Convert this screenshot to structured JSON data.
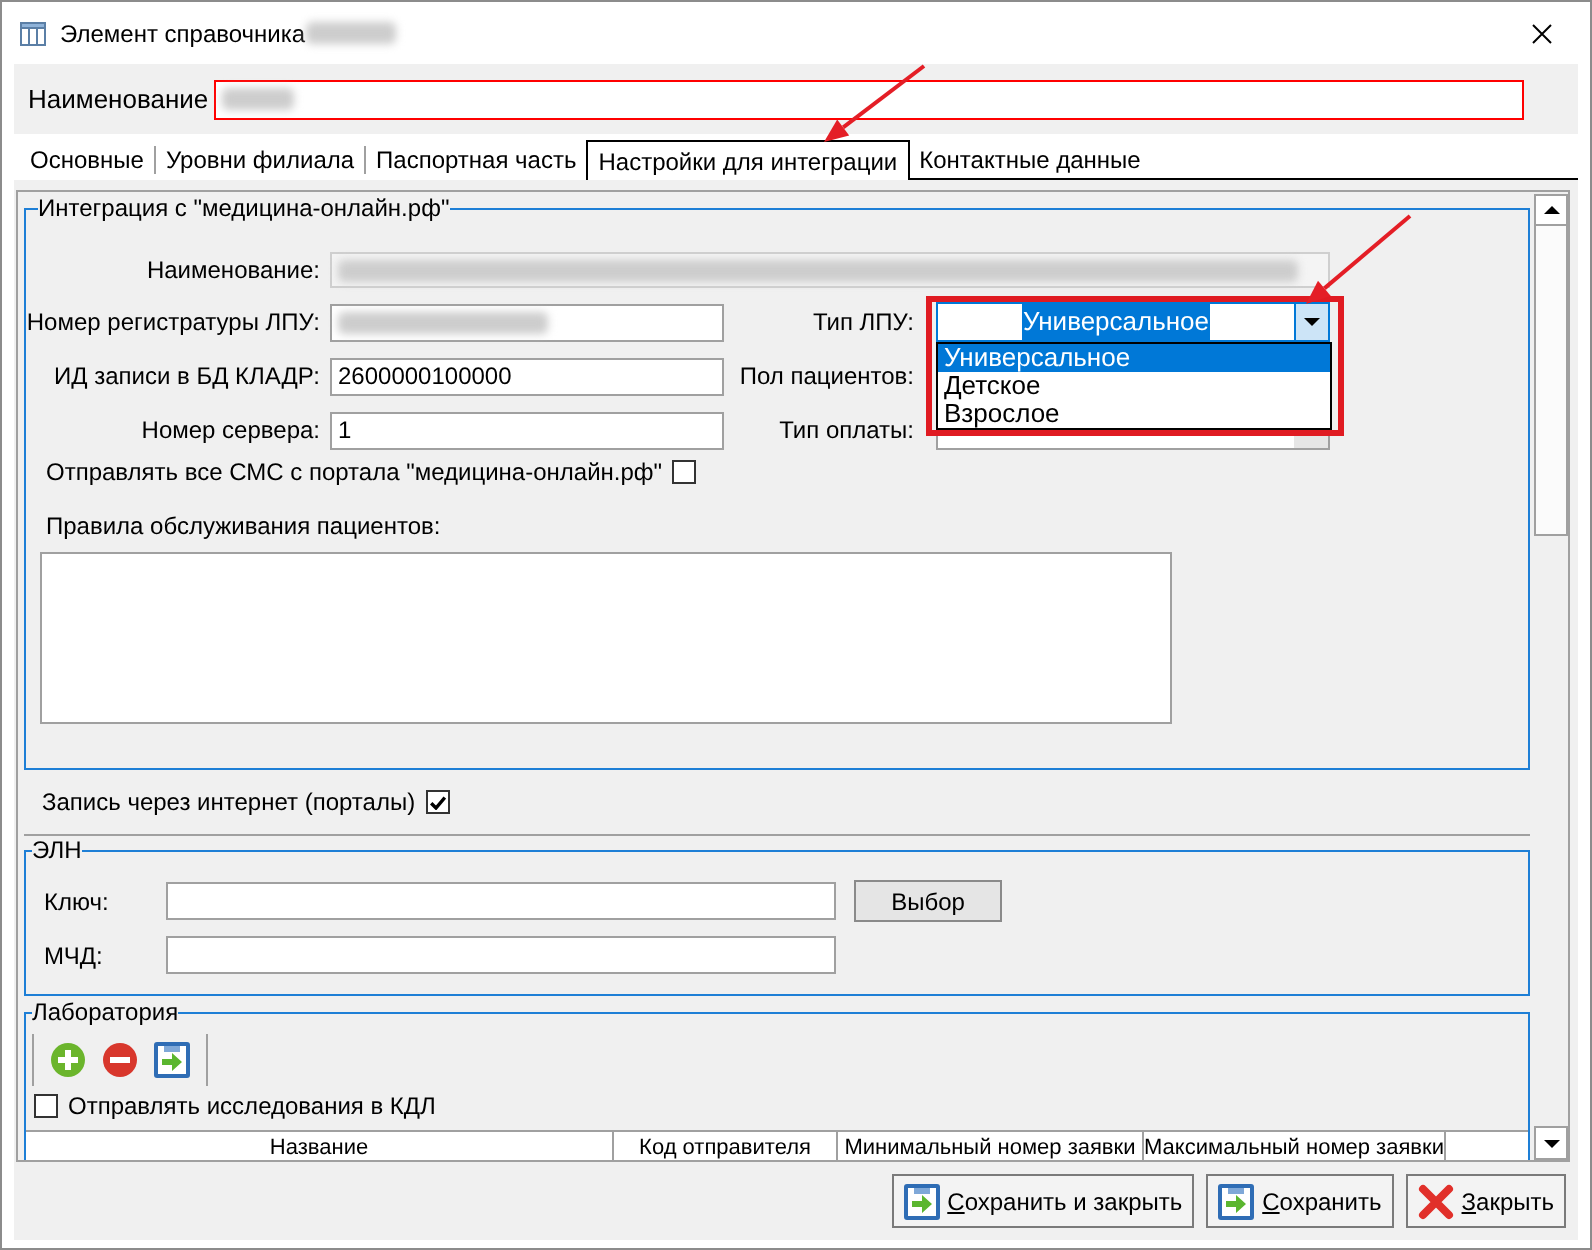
{
  "window": {
    "title": "Элемент справочника",
    "title_blurred": true
  },
  "name_field": {
    "label": "Наименование",
    "blurred": true,
    "invalid": true
  },
  "tabs": [
    {
      "label": "Основные",
      "selected": false
    },
    {
      "label": "Уровни филиала",
      "selected": false
    },
    {
      "label": "Паспортная часть",
      "selected": false
    },
    {
      "label": "Настройки для интеграции",
      "selected": true
    },
    {
      "label": "Контактные данные",
      "selected": false
    }
  ],
  "integration": {
    "title": "Интеграция с \"медицина-онлайн.рф\"",
    "name_field": {
      "label": "Наименование:",
      "disabled": true,
      "blurred": true
    },
    "left_fields": [
      {
        "label": "Номер регистратуры ЛПУ:",
        "blurred": true
      },
      {
        "label": "ИД записи в БД КЛАДР:",
        "value": "2600000100000"
      },
      {
        "label": "Номер сервера:",
        "value": "1"
      }
    ],
    "right_fields": [
      {
        "label": "Тип ЛПУ:",
        "dropdown": {
          "value": "Универсальное",
          "focused": true,
          "open": true,
          "options": [
            {
              "label": "Универсальное",
              "selected": true
            },
            {
              "label": "Детское",
              "selected": false
            },
            {
              "label": "Взрослое",
              "selected": false
            }
          ]
        }
      },
      {
        "label": "Пол пациентов:"
      },
      {
        "label": "Тип оплаты:",
        "dropdown": {
          "focused": false
        }
      }
    ],
    "sms_checkbox": {
      "label": "Отправлять все СМС с портала \"медицина-онлайн.рф\"",
      "checked": false
    },
    "rules": {
      "label": "Правила обслуживания пациентов:"
    }
  },
  "portal_checkbox": {
    "label": "Запись через интернет (порталы)",
    "checked": true
  },
  "eln": {
    "title": "ЭЛН",
    "fields": [
      {
        "label": "Ключ:",
        "button": "Выбор"
      },
      {
        "label": "МЧД:"
      }
    ]
  },
  "lab": {
    "title": "Лаборатория",
    "checkbox": {
      "label": "Отправлять исследования в КДЛ",
      "checked": false
    },
    "columns": [
      "Название",
      "Код отправителя",
      "Минимальный номер заявки",
      "Максимальный номер заявки"
    ]
  },
  "buttons": [
    {
      "label": "Сохранить и закрыть",
      "kind": "save_close"
    },
    {
      "label": "Сохранить",
      "kind": "save"
    },
    {
      "label": "Закрыть",
      "kind": "close"
    }
  ]
}
